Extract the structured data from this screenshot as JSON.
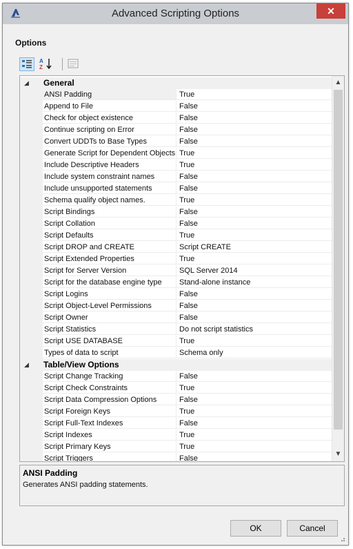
{
  "window": {
    "title": "Advanced Scripting Options",
    "close_glyph": "✕"
  },
  "options_label": "Options",
  "toolbar": {
    "icons": [
      "categorized-icon",
      "alphabetical-icon",
      "property-pages-icon"
    ]
  },
  "grid": {
    "categories": [
      {
        "toggle": "◢",
        "label": "General",
        "rows": [
          {
            "name": "ANSI Padding",
            "value": "True"
          },
          {
            "name": "Append to File",
            "value": "False"
          },
          {
            "name": "Check for object existence",
            "value": "False"
          },
          {
            "name": "Continue scripting on Error",
            "value": "False"
          },
          {
            "name": "Convert UDDTs to Base Types",
            "value": "False"
          },
          {
            "name": "Generate Script for Dependent Objects",
            "value": "True"
          },
          {
            "name": "Include Descriptive Headers",
            "value": "True"
          },
          {
            "name": "Include system constraint names",
            "value": "False"
          },
          {
            "name": "Include unsupported statements",
            "value": "False"
          },
          {
            "name": "Schema qualify object names.",
            "value": "True"
          },
          {
            "name": "Script Bindings",
            "value": "False"
          },
          {
            "name": "Script Collation",
            "value": "False"
          },
          {
            "name": "Script Defaults",
            "value": "True"
          },
          {
            "name": "Script DROP and CREATE",
            "value": "Script CREATE"
          },
          {
            "name": "Script Extended Properties",
            "value": "True"
          },
          {
            "name": "Script for Server Version",
            "value": "SQL Server 2014"
          },
          {
            "name": "Script for the database engine type",
            "value": "Stand-alone instance"
          },
          {
            "name": "Script Logins",
            "value": "False"
          },
          {
            "name": "Script Object-Level Permissions",
            "value": "False"
          },
          {
            "name": "Script Owner",
            "value": "False"
          },
          {
            "name": "Script Statistics",
            "value": "Do not script statistics"
          },
          {
            "name": "Script USE DATABASE",
            "value": "True"
          },
          {
            "name": "Types of data to script",
            "value": "Schema only"
          }
        ]
      },
      {
        "toggle": "◢",
        "label": "Table/View Options",
        "rows": [
          {
            "name": "Script Change Tracking",
            "value": "False"
          },
          {
            "name": "Script Check Constraints",
            "value": "True"
          },
          {
            "name": "Script Data Compression Options",
            "value": "False"
          },
          {
            "name": "Script Foreign Keys",
            "value": "True"
          },
          {
            "name": "Script Full-Text Indexes",
            "value": "False"
          },
          {
            "name": "Script Indexes",
            "value": "True"
          },
          {
            "name": "Script Primary Keys",
            "value": "True"
          },
          {
            "name": "Script Triggers",
            "value": "False"
          }
        ]
      }
    ],
    "selected_row": "ANSI Padding"
  },
  "scrollbar": {
    "up_glyph": "▲",
    "down_glyph": "▼"
  },
  "description": {
    "title": "ANSI Padding",
    "text": "Generates ANSI padding statements."
  },
  "buttons": {
    "ok": "OK",
    "cancel": "Cancel"
  },
  "colors": {
    "titlebar": "#c9ccd1",
    "close_button": "#c7403a",
    "toolbar_active": "#cde6f7"
  }
}
